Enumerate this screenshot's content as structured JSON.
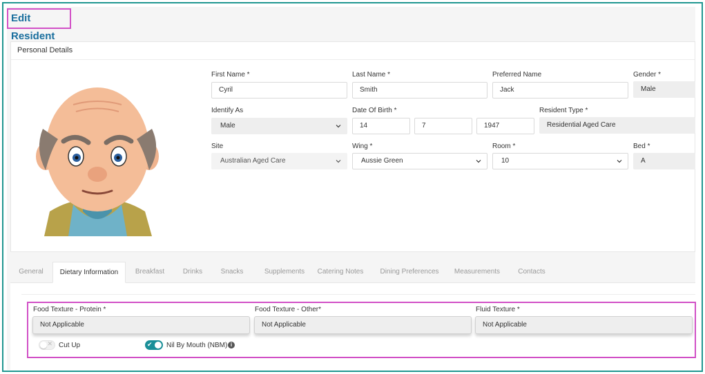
{
  "page": {
    "title": "Edit Resident"
  },
  "personal": {
    "header": "Personal Details",
    "first_name": {
      "label": "First Name *",
      "value": "Cyril"
    },
    "last_name": {
      "label": "Last Name *",
      "value": "Smith"
    },
    "preferred_name": {
      "label": "Preferred Name",
      "value": "Jack"
    },
    "gender": {
      "label": "Gender *",
      "value": "Male"
    },
    "identify_as": {
      "label": "Identify As",
      "value": "Male"
    },
    "dob": {
      "label": "Date Of Birth *",
      "day": "14",
      "month": "7",
      "year": "1947"
    },
    "resident_type": {
      "label": "Resident Type *",
      "value": "Residential Aged Care"
    },
    "site": {
      "label": "Site",
      "value": "Australian Aged Care"
    },
    "wing": {
      "label": "Wing *",
      "value": "Aussie Green"
    },
    "room": {
      "label": "Room *",
      "value": "10"
    },
    "bed": {
      "label": "Bed *",
      "value": "A"
    }
  },
  "tabs": [
    {
      "label": "General"
    },
    {
      "label": "Dietary Information",
      "active": true
    },
    {
      "label": "Breakfast"
    },
    {
      "label": "Drinks"
    },
    {
      "label": "Snacks"
    },
    {
      "label": "Supplements"
    },
    {
      "label": "Catering Notes"
    },
    {
      "label": "Dining Preferences"
    },
    {
      "label": "Measurements"
    },
    {
      "label": "Contacts"
    }
  ],
  "dietary": {
    "food_texture_protein": {
      "label": "Food Texture - Protein *",
      "value": "Not Applicable"
    },
    "food_texture_other": {
      "label": "Food Texture - Other*",
      "value": "Not Applicable"
    },
    "fluid_texture": {
      "label": "Fluid Texture *",
      "value": "Not Applicable"
    },
    "cut_up": {
      "label": "Cut Up",
      "checked": false
    },
    "nbm": {
      "label": "Nil By Mouth (NBM)",
      "checked": true
    }
  },
  "colors": {
    "accent": "#1a8f98",
    "frame": "#1f9690",
    "highlight": "#d14fc6",
    "title": "#1a6f9e"
  },
  "icons": {
    "info": "info-icon",
    "dropdown": "chevron-down-icon"
  }
}
